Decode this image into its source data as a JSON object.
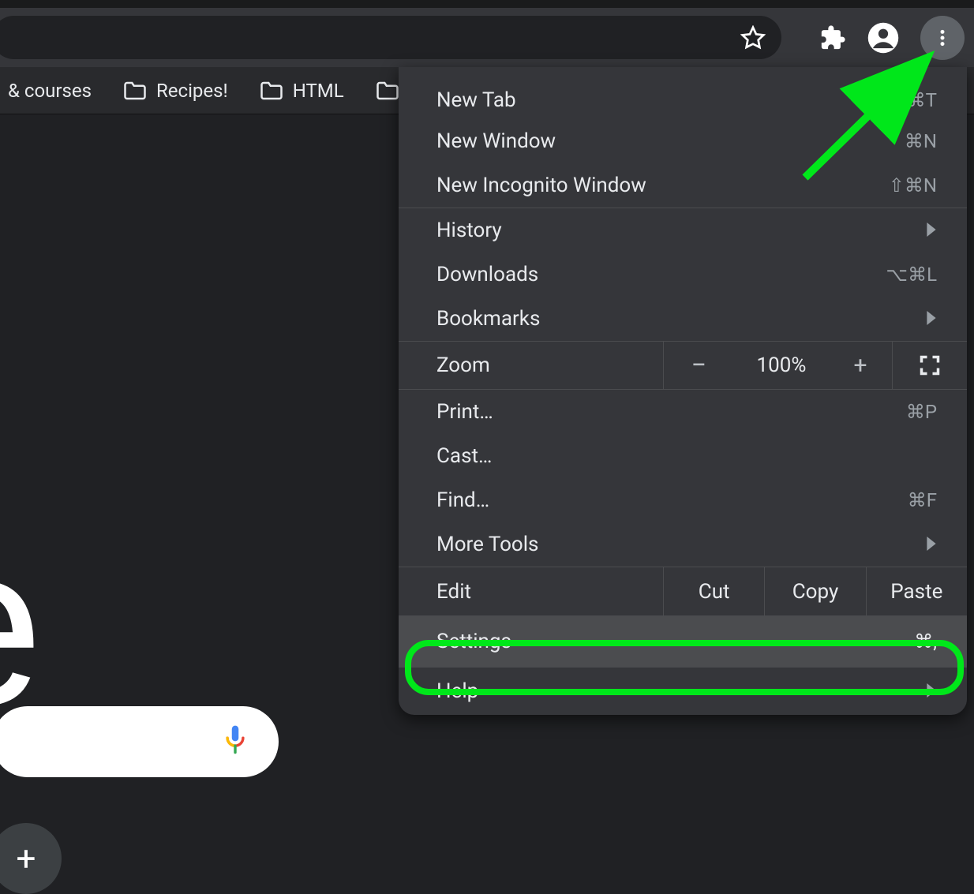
{
  "toolbar": {
    "star_icon": "star",
    "ext_icon": "extension",
    "profile_icon": "profile",
    "more_icon": "more-vert"
  },
  "bookmarks": [
    {
      "label": "& courses",
      "has_folder": false
    },
    {
      "label": "Recipes!",
      "has_folder": true
    },
    {
      "label": "HTML",
      "has_folder": true
    },
    {
      "label": "",
      "has_folder": true
    }
  ],
  "menu": {
    "new_tab": {
      "label": "New Tab",
      "shortcut": "⌘T"
    },
    "new_window": {
      "label": "New Window",
      "shortcut": "⌘N"
    },
    "incognito": {
      "label": "New Incognito Window",
      "shortcut": "⇧⌘N"
    },
    "history": {
      "label": "History"
    },
    "downloads": {
      "label": "Downloads",
      "shortcut": "⌥⌘L"
    },
    "bookmarks": {
      "label": "Bookmarks"
    },
    "zoom": {
      "label": "Zoom",
      "minus": "−",
      "percent": "100%",
      "plus": "+"
    },
    "print": {
      "label": "Print…",
      "shortcut": "⌘P"
    },
    "cast": {
      "label": "Cast…"
    },
    "find": {
      "label": "Find…",
      "shortcut": "⌘F"
    },
    "more_tools": {
      "label": "More Tools"
    },
    "edit": {
      "label": "Edit",
      "cut": "Cut",
      "copy": "Copy",
      "paste": "Paste"
    },
    "settings": {
      "label": "Settings",
      "shortcut": "⌘,"
    },
    "help": {
      "label": "Help"
    }
  },
  "page": {
    "glyph": "e",
    "add_plus": "+"
  },
  "colors": {
    "annotation": "#00e71a"
  }
}
